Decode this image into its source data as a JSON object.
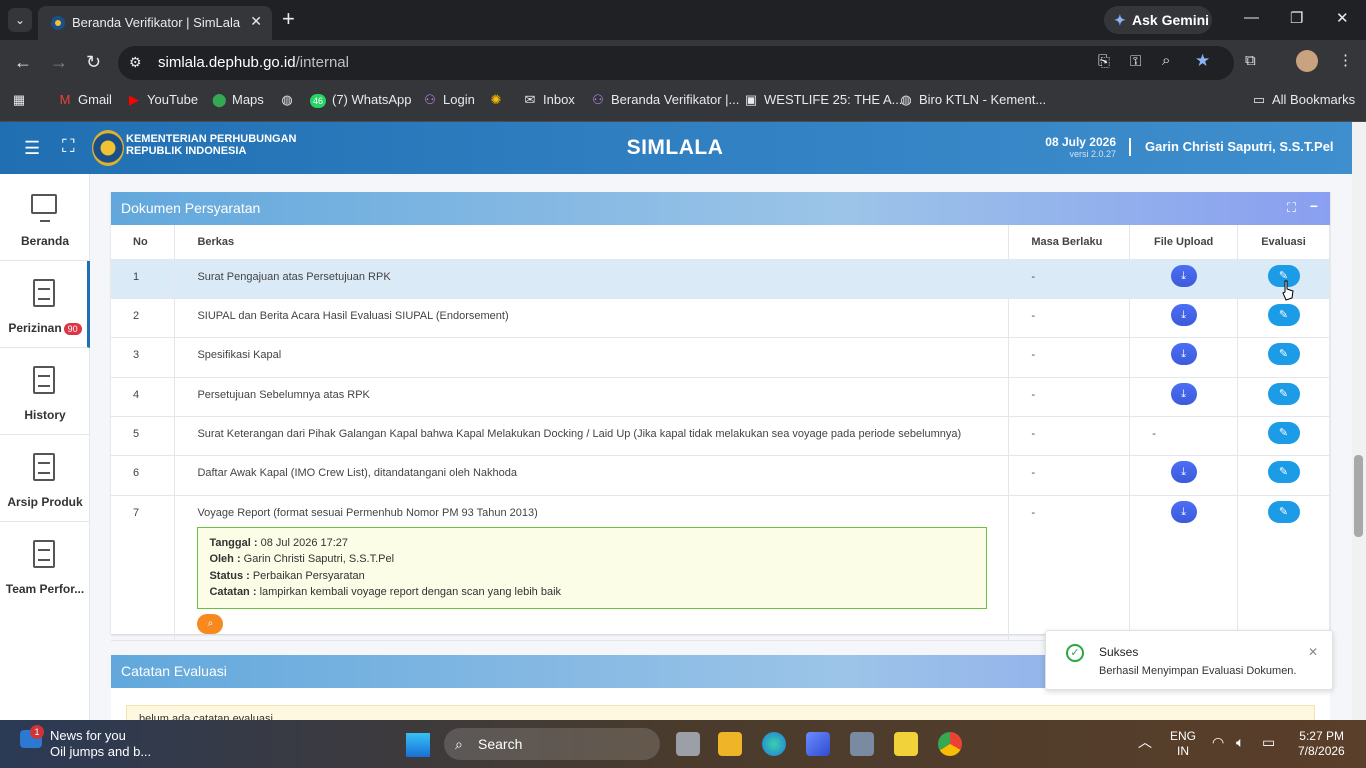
{
  "browser": {
    "tab_title": "Beranda Verifikator | SimLala",
    "ask_gemini": "Ask Gemini",
    "url_host": "simlala.dephub.go.id",
    "url_path": "/internal",
    "bookmarks": [
      "Gmail",
      "YouTube",
      "Maps",
      "(7) WhatsApp",
      "Login",
      "Inbox",
      "Beranda Verifikator |...",
      "WESTLIFE 25: THE A...",
      "Biro KTLN - Kement..."
    ],
    "whatsapp_badge": "46",
    "all_bookmarks": "All Bookmarks"
  },
  "header": {
    "org_line1": "KEMENTERIAN PERHUBUNGAN",
    "org_line2": "REPUBLIK INDONESIA",
    "app_title": "SIMLALA",
    "date": "08 July 2026",
    "version": "versi 2.0.27",
    "user": "Garin Christi Saputri, S.S.T.Pel"
  },
  "sidebar": {
    "items": [
      {
        "label": "Beranda",
        "icon": "monitor-icon"
      },
      {
        "label": "Perizinan",
        "icon": "document-icon",
        "badge": "90"
      },
      {
        "label": "History",
        "icon": "document-icon"
      },
      {
        "label": "Arsip Produk",
        "icon": "document-icon"
      },
      {
        "label": "Team Perfor...",
        "icon": "document-icon"
      }
    ]
  },
  "dokumen": {
    "title": "Dokumen Persyaratan",
    "columns": [
      "No",
      "Berkas",
      "Masa Berlaku",
      "File Upload",
      "Evaluasi"
    ],
    "rows": [
      {
        "no": "1",
        "berkas": "Surat Pengajuan atas Persetujuan RPK",
        "masa": "-",
        "file": "download"
      },
      {
        "no": "2",
        "berkas": "SIUPAL dan Berita Acara Hasil Evaluasi SIUPAL (Endorsement)",
        "masa": "-",
        "file": "download"
      },
      {
        "no": "3",
        "berkas": "Spesifikasi Kapal",
        "masa": "-",
        "file": "download"
      },
      {
        "no": "4",
        "berkas": "Persetujuan Sebelumnya atas RPK",
        "masa": "-",
        "file": "download"
      },
      {
        "no": "5",
        "berkas": "Surat Keterangan dari Pihak Galangan Kapal bahwa Kapal Melakukan Docking / Laid Up (Jika kapal tidak melakukan sea voyage pada periode sebelumnya)",
        "masa": "-",
        "file": "-"
      },
      {
        "no": "6",
        "berkas": "Daftar Awak Kapal (IMO Crew List), ditandatangani oleh Nakhoda",
        "masa": "-",
        "file": "download"
      },
      {
        "no": "7",
        "berkas": "Voyage Report (format sesuai Permenhub Nomor PM 93 Tahun 2013)",
        "masa": "-",
        "file": "download"
      }
    ],
    "note": {
      "tanggal_label": "Tanggal :",
      "tanggal": "08 Jul 2026 17:27",
      "oleh_label": "Oleh :",
      "oleh": "Garin Christi Saputri, S.S.T.Pel",
      "status_label": "Status :",
      "status": "Perbaikan Persyaratan",
      "catatan_label": "Catatan :",
      "catatan": "lampirkan kembali voyage report dengan scan yang lebih baik"
    }
  },
  "catatan": {
    "title": "Catatan Evaluasi",
    "empty": "belum ada catatan evaluasi"
  },
  "toast": {
    "title": "Sukses",
    "message": "Berhasil Menyimpan Evaluasi Dokumen."
  },
  "taskbar": {
    "news_title": "News for you",
    "news_sub": "Oil jumps and b...",
    "news_badge": "1",
    "search": "Search",
    "lang1": "ENG",
    "lang2": "IN",
    "time": "5:27 PM",
    "date": "7/8/2026"
  },
  "colors": {
    "header": "#1f6fb2",
    "download": "#3b5bdb",
    "evaluasi": "#1c9be6",
    "search_btn": "#f7891f"
  }
}
